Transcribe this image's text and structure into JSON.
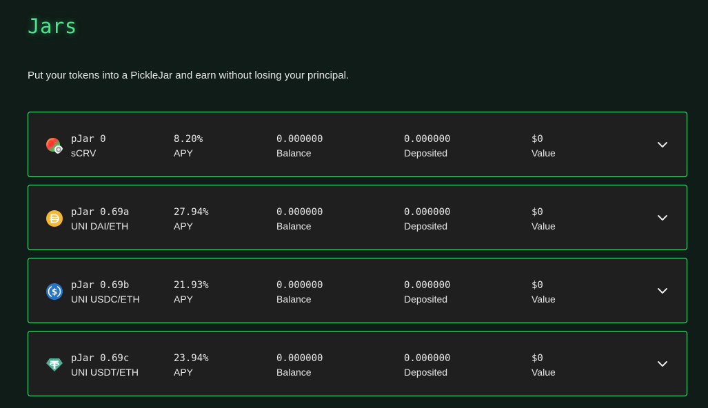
{
  "page": {
    "title": "Jars",
    "subtitle": "Put your tokens into a PickleJar and earn without losing your principal."
  },
  "jars": [
    {
      "name": "pJar 0",
      "pair": "sCRV",
      "apy": "8.20%",
      "apy_label": "APY",
      "balance": "0.000000",
      "balance_label": "Balance",
      "deposited": "0.000000",
      "deposited_label": "Deposited",
      "value": "$0",
      "value_label": "Value",
      "icon": "scrv-token-icon"
    },
    {
      "name": "pJar 0.69a",
      "pair": "UNI DAI/ETH",
      "apy": "27.94%",
      "apy_label": "APY",
      "balance": "0.000000",
      "balance_label": "Balance",
      "deposited": "0.000000",
      "deposited_label": "Deposited",
      "value": "$0",
      "value_label": "Value",
      "icon": "dai-token-icon"
    },
    {
      "name": "pJar 0.69b",
      "pair": "UNI USDC/ETH",
      "apy": "21.93%",
      "apy_label": "APY",
      "balance": "0.000000",
      "balance_label": "Balance",
      "deposited": "0.000000",
      "deposited_label": "Deposited",
      "value": "$0",
      "value_label": "Value",
      "icon": "usdc-token-icon"
    },
    {
      "name": "pJar 0.69c",
      "pair": "UNI USDT/ETH",
      "apy": "23.94%",
      "apy_label": "APY",
      "balance": "0.000000",
      "balance_label": "Balance",
      "deposited": "0.000000",
      "deposited_label": "Deposited",
      "value": "$0",
      "value_label": "Value",
      "icon": "usdt-token-icon"
    }
  ],
  "colors": {
    "accent": "#4be68c",
    "background": "#0f1c17",
    "card": "#1f1f1f",
    "dai": "#f4b731",
    "usdc": "#2775ca",
    "usdt": "#50af95"
  }
}
